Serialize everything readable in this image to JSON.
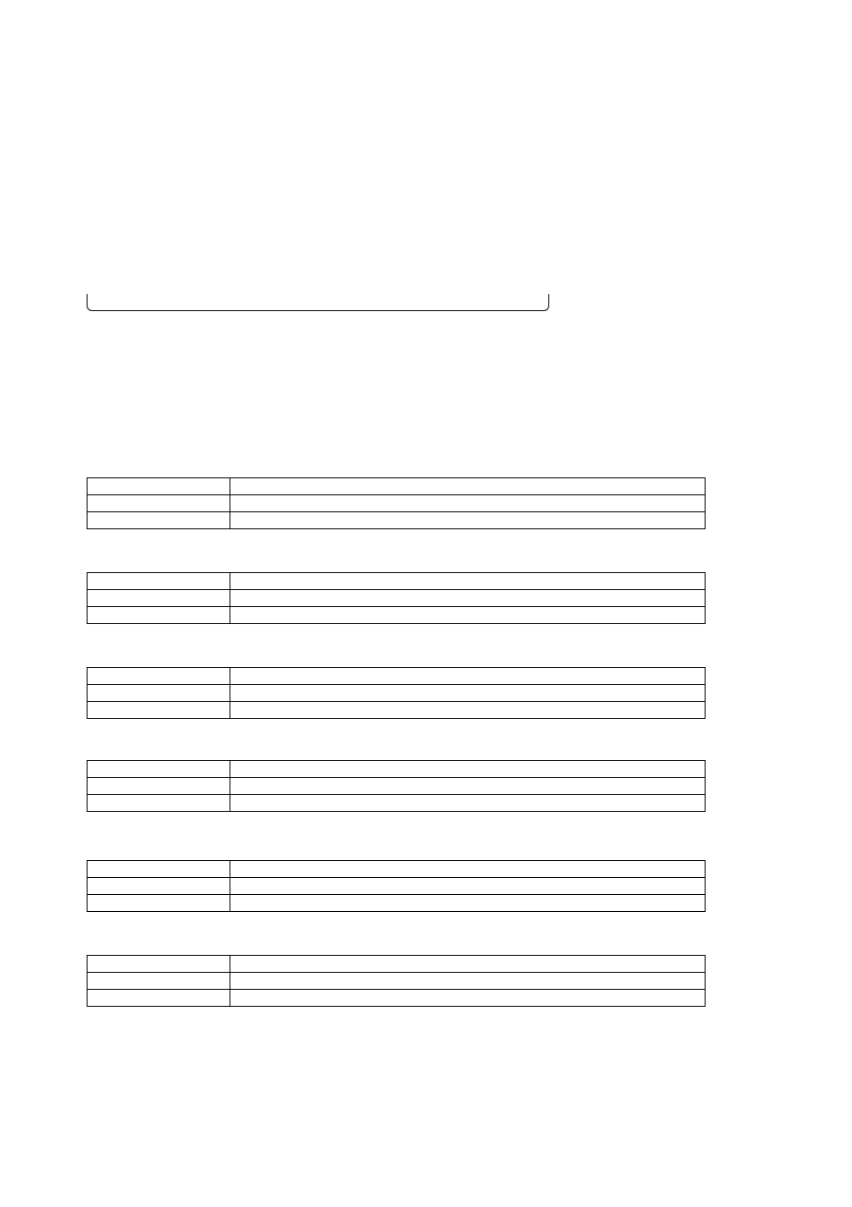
{
  "box": {
    "content": ""
  },
  "tables": [
    {
      "rows": [
        {
          "c1": "",
          "c2": ""
        },
        {
          "c1": "",
          "c2": ""
        },
        {
          "c1": "",
          "c2": ""
        }
      ]
    },
    {
      "rows": [
        {
          "c1": "",
          "c2": ""
        },
        {
          "c1": "",
          "c2": ""
        },
        {
          "c1": "",
          "c2": ""
        }
      ]
    },
    {
      "rows": [
        {
          "c1": "",
          "c2": ""
        },
        {
          "c1": "",
          "c2": ""
        },
        {
          "c1": "",
          "c2": ""
        }
      ]
    },
    {
      "rows": [
        {
          "c1": "",
          "c2": ""
        },
        {
          "c1": "",
          "c2": ""
        },
        {
          "c1": "",
          "c2": ""
        }
      ]
    },
    {
      "rows": [
        {
          "c1": "",
          "c2": ""
        },
        {
          "c1": "",
          "c2": ""
        },
        {
          "c1": "",
          "c2": ""
        }
      ]
    },
    {
      "rows": [
        {
          "c1": "",
          "c2": ""
        },
        {
          "c1": "",
          "c2": ""
        },
        {
          "c1": "",
          "c2": ""
        }
      ]
    }
  ]
}
